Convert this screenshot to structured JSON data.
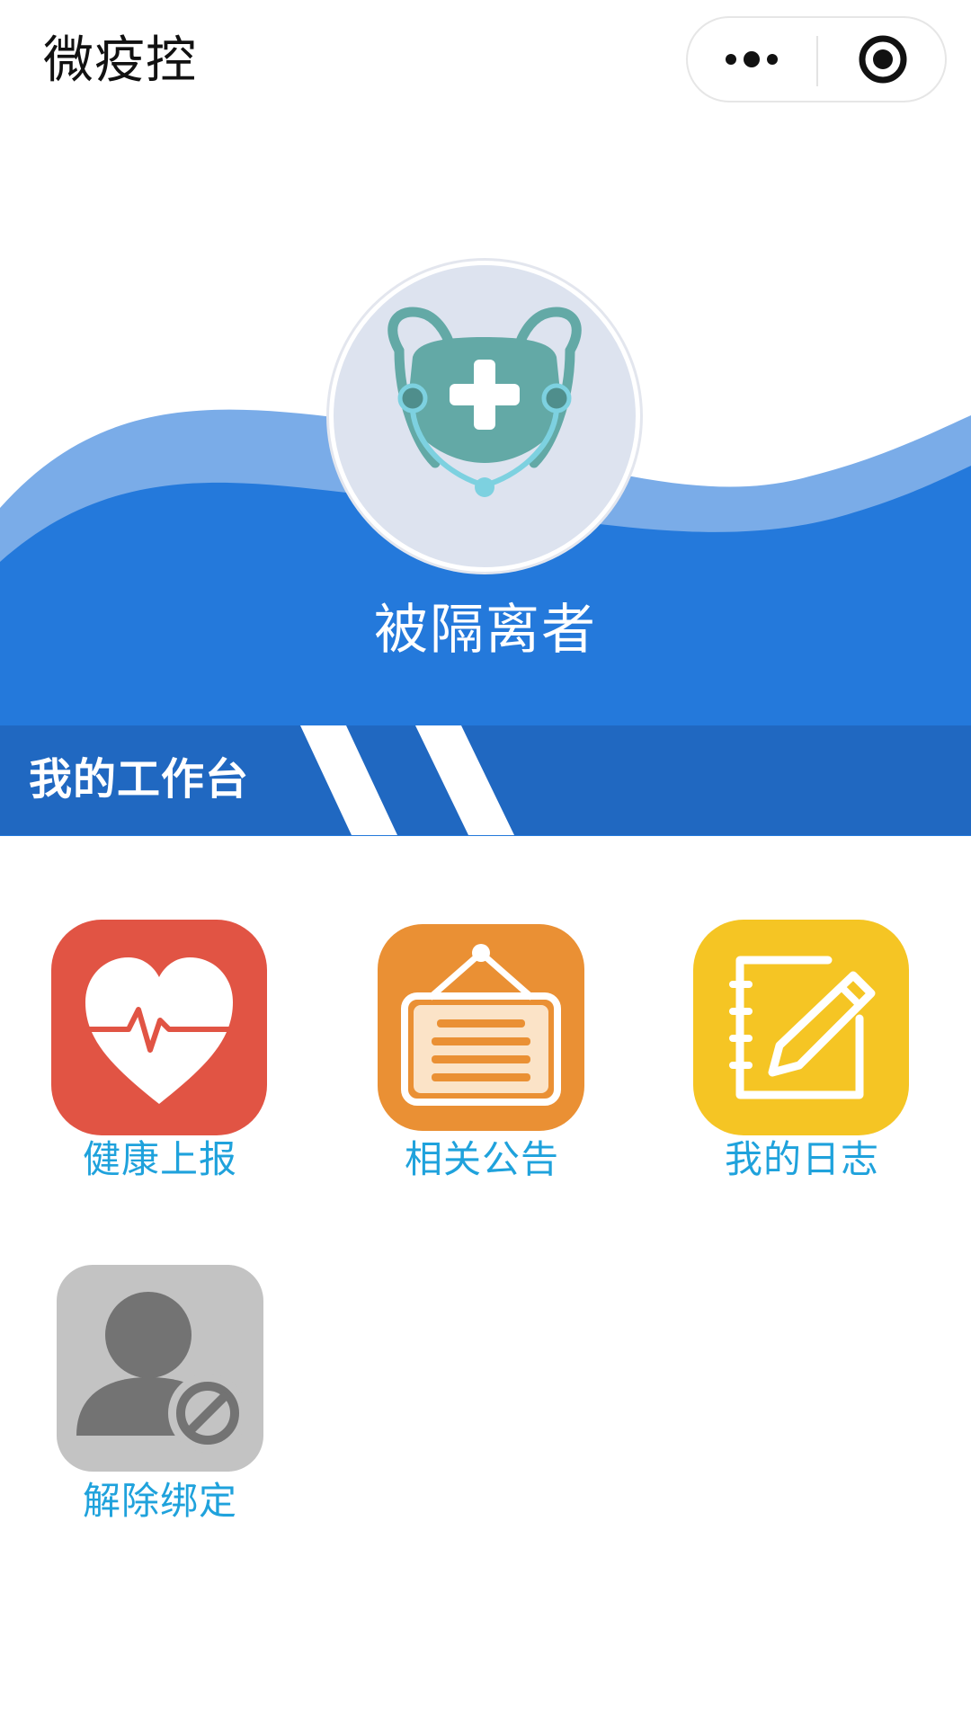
{
  "navbar": {
    "title": "微疫控",
    "menu_icon": "more-dots-icon",
    "close_icon": "record-circle-icon"
  },
  "hero": {
    "avatar_icon": "medical-mask-stethoscope-icon",
    "role_name": "被隔离者"
  },
  "workbench": {
    "title": "我的工作台"
  },
  "grid": {
    "items": [
      {
        "label": "健康上报",
        "icon": "heart-pulse-icon",
        "color": "#e15444"
      },
      {
        "label": "相关公告",
        "icon": "notice-board-icon",
        "color": "#ea9034"
      },
      {
        "label": "我的日志",
        "icon": "notebook-pencil-icon",
        "color": "#f5c524"
      },
      {
        "label": "解除绑定",
        "icon": "user-forbidden-icon",
        "color": "#c3c3c3"
      }
    ]
  },
  "colors": {
    "primary_blue": "#2479db",
    "light_wave": "#7aace8",
    "workbench_bar": "#2068c1",
    "label_blue": "#1fa2dc"
  }
}
